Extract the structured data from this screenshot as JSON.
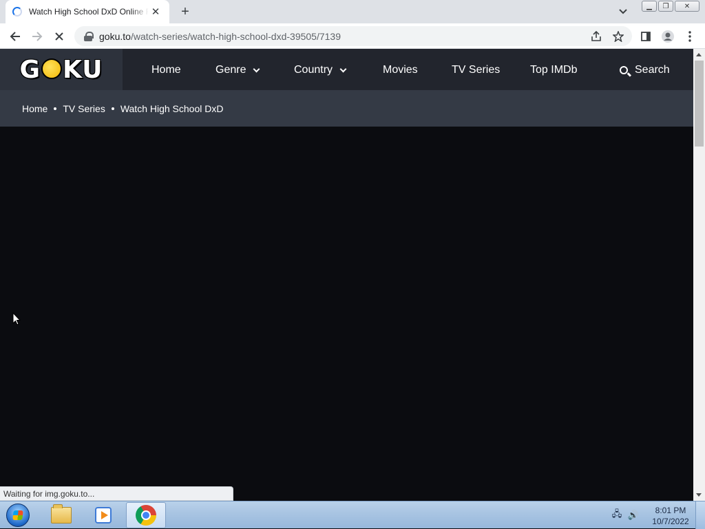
{
  "browser": {
    "tab_title": "Watch High School DxD Online Free",
    "new_tab_label": "+",
    "url_host": "goku.to",
    "url_path": "/watch-series/watch-high-school-dxd-39505/7139",
    "status_text": "Waiting for img.goku.to..."
  },
  "site": {
    "logo_text_left": "G",
    "logo_text_right": "KU",
    "nav": {
      "home": "Home",
      "genre": "Genre",
      "country": "Country",
      "movies": "Movies",
      "tv_series": "TV Series",
      "top_imdb": "Top IMDb",
      "search": "Search"
    },
    "breadcrumb": [
      "Home",
      "TV Series",
      "Watch High School DxD"
    ]
  },
  "taskbar": {
    "time": "8:01 PM",
    "date": "10/7/2022"
  },
  "colors": {
    "header_bg": "#22252d",
    "breadcrumb_bg": "#343a45",
    "page_bg": "#0b0c10",
    "logo_accent": "#f2b705"
  }
}
